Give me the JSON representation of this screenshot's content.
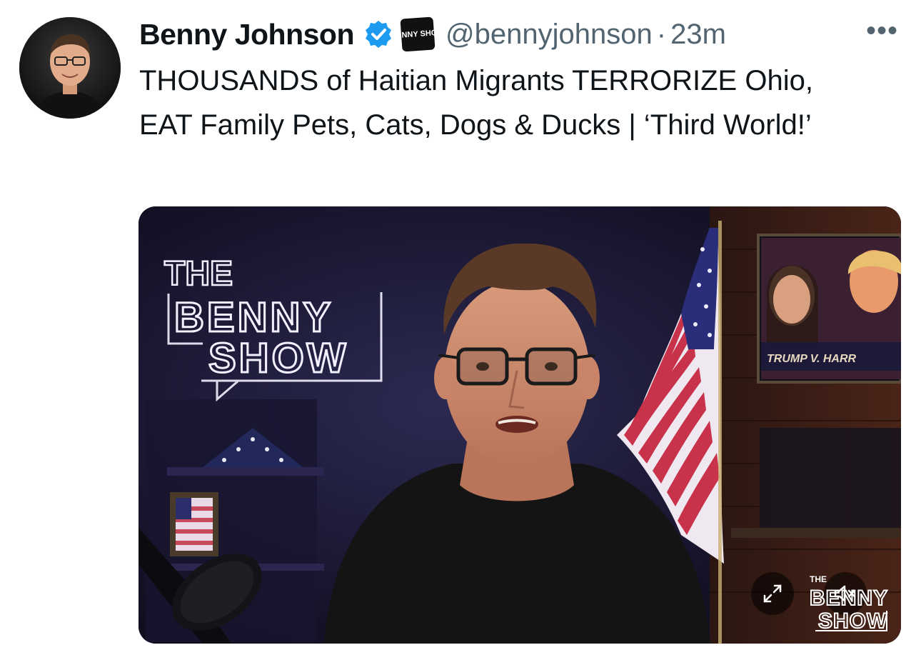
{
  "tweet": {
    "author_name": "Benny Johnson",
    "handle": "@bennyjohnson",
    "separator": "·",
    "time_ago": "23m",
    "more_icon": "more-horizontal-icon",
    "more_glyph": "•••",
    "affiliation_badge": "BENNY SHOW",
    "text": "THOUSANDS of Haitian Migrants TERRORIZE Ohio, EAT Family Pets, Cats, Dogs & Ducks | ‘Third World!’"
  },
  "media": {
    "neon_sign": {
      "line1": "THE",
      "line2": "BENNY",
      "line3": "SHOW"
    },
    "wall_screen_caption": "TRUMP V. HARR",
    "watermark": {
      "line1": "THE",
      "line2": "BENNY",
      "line3": "SHOW"
    },
    "controls": {
      "expand_icon": "expand-icon",
      "mute_icon": "muted-speaker-icon"
    }
  },
  "colors": {
    "verified_blue": "#1d9bf0",
    "secondary_text": "#536471",
    "primary_text": "#0f1419"
  }
}
